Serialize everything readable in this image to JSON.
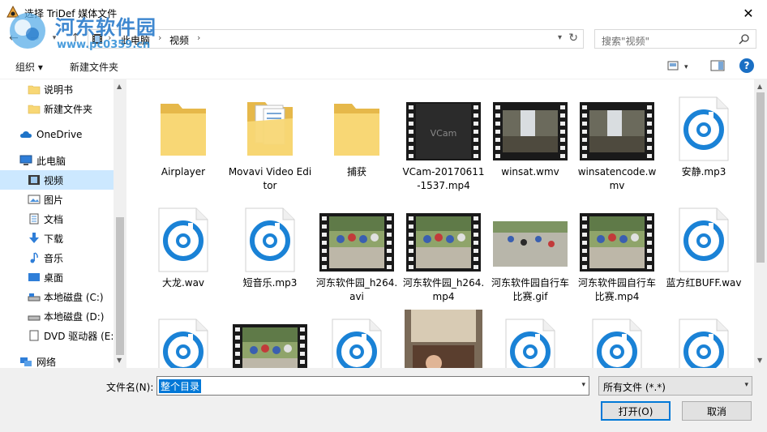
{
  "window": {
    "title": "选择 TriDef 媒体文件",
    "close_glyph": "✕"
  },
  "watermark": {
    "text": "河东软件园",
    "url": "www.pc0359.cn"
  },
  "nav": {
    "breadcrumb": [
      "此电脑",
      "视频"
    ],
    "search_placeholder": "搜索\"视频\""
  },
  "toolbar": {
    "organize": "组织 ▾",
    "new_folder": "新建文件夹",
    "help": "?"
  },
  "sidebar": {
    "items": [
      {
        "label": "说明书",
        "icon": "folder-icon"
      },
      {
        "label": "新建文件夹",
        "icon": "folder-icon"
      },
      {
        "label": "OneDrive",
        "icon": "cloud-icon"
      },
      {
        "label": "此电脑",
        "icon": "computer-icon"
      },
      {
        "label": "视频",
        "icon": "video-icon",
        "selected": true
      },
      {
        "label": "图片",
        "icon": "pictures-icon"
      },
      {
        "label": "文档",
        "icon": "documents-icon"
      },
      {
        "label": "下载",
        "icon": "download-icon"
      },
      {
        "label": "音乐",
        "icon": "music-icon"
      },
      {
        "label": "桌面",
        "icon": "desktop-icon"
      },
      {
        "label": "本地磁盘 (C:)",
        "icon": "drive-icon"
      },
      {
        "label": "本地磁盘 (D:)",
        "icon": "drive-icon"
      },
      {
        "label": "DVD 驱动器 (E:",
        "icon": "dvd-icon"
      },
      {
        "label": "网络",
        "icon": "network-icon"
      }
    ]
  },
  "files": [
    {
      "name": "Airplayer",
      "type": "folder"
    },
    {
      "name": "Movavi Video Editor",
      "type": "folder-docs"
    },
    {
      "name": "捕获",
      "type": "folder"
    },
    {
      "name": "VCam-20170611-1537.mp4",
      "type": "video-dark"
    },
    {
      "name": "winsat.wmv",
      "type": "video-water"
    },
    {
      "name": "winsatencode.wmv",
      "type": "video-water"
    },
    {
      "name": "安静.mp3",
      "type": "audio"
    },
    {
      "name": "大龙.wav",
      "type": "audio"
    },
    {
      "name": "短音乐.mp3",
      "type": "audio"
    },
    {
      "name": "河东软件园_h264.avi",
      "type": "video-bike"
    },
    {
      "name": "河东软件园_h264.mp4",
      "type": "video-bike"
    },
    {
      "name": "河东软件园自行车比赛.gif",
      "type": "image-bike"
    },
    {
      "name": "河东软件园自行车比赛.mp4",
      "type": "video-bike"
    },
    {
      "name": "蓝方红BUFF.wav",
      "type": "audio"
    },
    {
      "name": "",
      "type": "audio"
    },
    {
      "name": "",
      "type": "video-bike"
    },
    {
      "name": "",
      "type": "audio"
    },
    {
      "name": "",
      "type": "image-album"
    },
    {
      "name": "",
      "type": "audio"
    },
    {
      "name": "",
      "type": "audio"
    },
    {
      "name": "",
      "type": "audio"
    }
  ],
  "footer": {
    "filename_label": "文件名(N):",
    "filename_value": "整个目录",
    "filetype": "所有文件 (*.*)",
    "open": "打开(O)",
    "cancel": "取消"
  },
  "colors": {
    "accent": "#0078d7",
    "selection": "#cce8ff",
    "audio_ring": "#1a82d6",
    "folder": "#f8d775"
  }
}
